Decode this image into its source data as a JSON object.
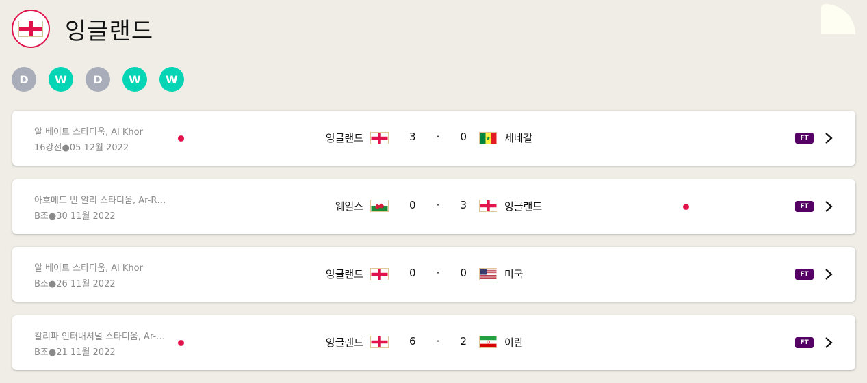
{
  "team": {
    "name": "잉글랜드",
    "flag_icon": "england-flag-icon"
  },
  "form": [
    "D",
    "W",
    "D",
    "W",
    "W"
  ],
  "colors": {
    "accent": "#e2134c",
    "win": "#05d5b5",
    "draw": "#a8adb9",
    "ft_badge": "#550065"
  },
  "matches": [
    {
      "venue": "알 베이트 스타디움, Al Khor",
      "meta": "16강전●05 12월 2022",
      "home": "잉글랜드",
      "home_flag": "england",
      "home_score": "3",
      "sep": "·",
      "away_score": "0",
      "away": "세네갈",
      "away_flag": "senegal",
      "status": "FT",
      "dot": "left"
    },
    {
      "venue": "아흐메드 빈 알리 스타디움, Ar-R…",
      "meta": "B조●30 11월 2022",
      "home": "웨일스",
      "home_flag": "wales",
      "home_score": "0",
      "sep": "·",
      "away_score": "3",
      "away": "잉글랜드",
      "away_flag": "england",
      "status": "FT",
      "dot": "right"
    },
    {
      "venue": "알 베이트 스타디움, Al Khor",
      "meta": "B조●26 11월 2022",
      "home": "잉글랜드",
      "home_flag": "england",
      "home_score": "0",
      "sep": "·",
      "away_score": "0",
      "away": "미국",
      "away_flag": "usa",
      "status": "FT",
      "dot": "none"
    },
    {
      "venue": "칼리파 인터내셔널 스타디움, Ar-…",
      "meta": "B조●21 11월 2022",
      "home": "잉글랜드",
      "home_flag": "england",
      "home_score": "6",
      "sep": "·",
      "away_score": "2",
      "away": "이란",
      "away_flag": "iran",
      "status": "FT",
      "dot": "left"
    }
  ]
}
